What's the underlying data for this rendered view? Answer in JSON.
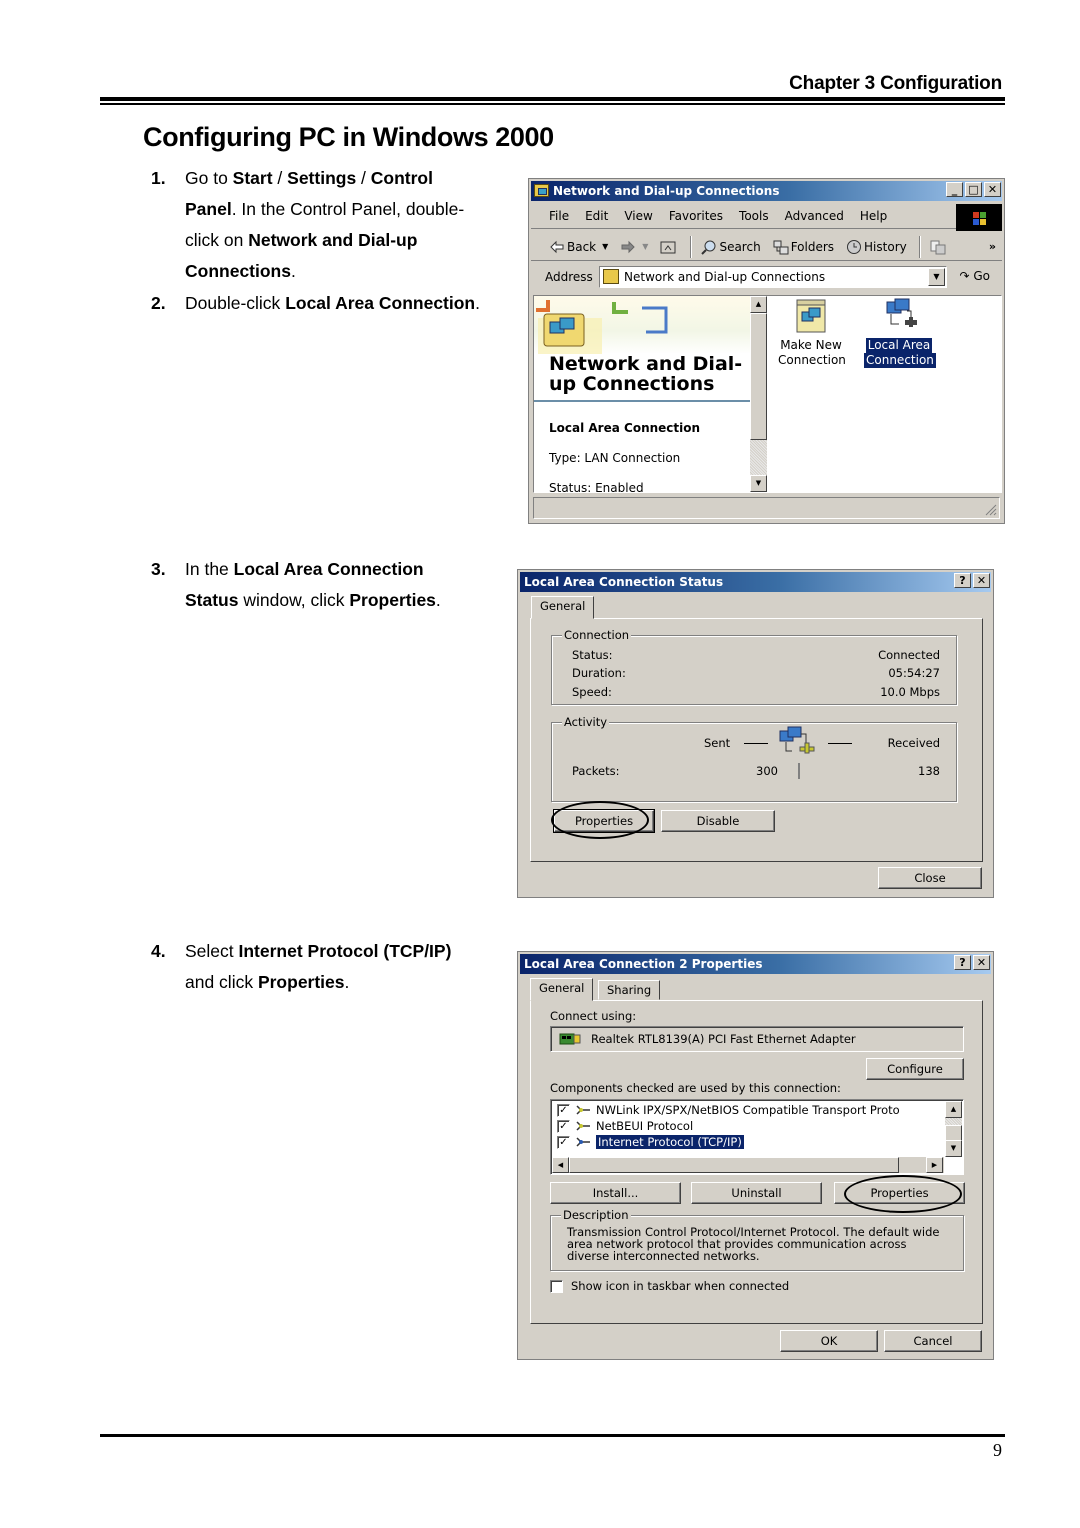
{
  "header": {
    "chapter": "Chapter 3 Configuration",
    "title": "Configuring PC in Windows 2000"
  },
  "steps": [
    {
      "num": "1.",
      "lines": [
        [
          {
            "t": "Go to ",
            "b": false
          },
          {
            "t": "Start",
            "b": true
          },
          {
            "t": " / ",
            "b": false
          },
          {
            "t": "Settings",
            "b": true
          },
          {
            "t": " / ",
            "b": false
          },
          {
            "t": "Control",
            "b": true
          }
        ],
        [
          {
            "t": "Panel",
            "b": true
          },
          {
            "t": ". In the Control Panel, double-",
            "b": false
          }
        ],
        [
          {
            "t": "click on ",
            "b": false
          },
          {
            "t": "Network and Dial-up",
            "b": true
          }
        ],
        [
          {
            "t": "Connections",
            "b": true
          },
          {
            "t": ".",
            "b": false
          }
        ]
      ]
    },
    {
      "num": "2.",
      "lines": [
        [
          {
            "t": "Double-click ",
            "b": false
          },
          {
            "t": "Local Area Connection",
            "b": true
          },
          {
            "t": ".",
            "b": false
          }
        ]
      ]
    },
    {
      "num": "3.",
      "lines": [
        [
          {
            "t": "In the ",
            "b": false
          },
          {
            "t": "Local Area Connection",
            "b": true
          }
        ],
        [
          {
            "t": "Status",
            "b": true
          },
          {
            "t": " window, click ",
            "b": false
          },
          {
            "t": "Properties",
            "b": true
          },
          {
            "t": ".",
            "b": false
          }
        ]
      ]
    },
    {
      "num": "4.",
      "lines": [
        [
          {
            "t": "Select ",
            "b": false
          },
          {
            "t": "Internet Protocol (TCP/IP)",
            "b": true
          }
        ],
        [
          {
            "t": "and click ",
            "b": false
          },
          {
            "t": "Properties",
            "b": true
          },
          {
            "t": ".",
            "b": false
          }
        ]
      ]
    }
  ],
  "window_network": {
    "title": "Network and Dial-up Connections",
    "menu": [
      "File",
      "Edit",
      "View",
      "Favorites",
      "Tools",
      "Advanced",
      "Help"
    ],
    "toolbar": {
      "back": "Back",
      "search": "Search",
      "folders": "Folders",
      "history": "History",
      "more": "»"
    },
    "address_label": "Address",
    "address_value": "Network and Dial-up Connections",
    "go_label": "Go",
    "left_pane": {
      "title": "Network and Dial-up Connections",
      "item_name": "Local Area Connection",
      "type": "Type: LAN Connection",
      "status": "Status: Enabled"
    },
    "icons": [
      {
        "line1": "Make New",
        "line2": "Connection",
        "selected": false
      },
      {
        "line1": "Local Area",
        "line2": "Connection",
        "selected": true
      }
    ]
  },
  "window_status": {
    "title": "Local Area Connection Status",
    "tab": "General",
    "connection_group": "Connection",
    "status_label": "Status:",
    "status_value": "Connected",
    "duration_label": "Duration:",
    "duration_value": "05:54:27",
    "speed_label": "Speed:",
    "speed_value": "10.0 Mbps",
    "activity_group": "Activity",
    "sent_label": "Sent",
    "received_label": "Received",
    "packets_label": "Packets:",
    "packets_sent": "300",
    "packets_received": "138",
    "properties_button": "Properties",
    "disable_button": "Disable",
    "close_button": "Close"
  },
  "window_properties": {
    "title": "Local Area Connection 2 Properties",
    "tabs": [
      "General",
      "Sharing"
    ],
    "connect_using_label": "Connect using:",
    "adapter": "Realtek RTL8139(A) PCI Fast Ethernet Adapter",
    "configure_button": "Configure",
    "components_label": "Components checked are used by this connection:",
    "components": [
      {
        "label": "NWLink IPX/SPX/NetBIOS Compatible Transport Proto",
        "checked": true,
        "selected": false
      },
      {
        "label": "NetBEUI Protocol",
        "checked": true,
        "selected": false
      },
      {
        "label": "Internet Protocol (TCP/IP)",
        "checked": true,
        "selected": true
      }
    ],
    "install_button": "Install...",
    "uninstall_button": "Uninstall",
    "properties_button": "Properties",
    "description_group": "Description",
    "description": "Transmission Control Protocol/Internet Protocol. The default wide area network protocol that provides communication across diverse interconnected networks.",
    "show_icon_label": "Show icon in taskbar when connected",
    "show_icon_checked": false,
    "ok_button": "OK",
    "cancel_button": "Cancel"
  },
  "footer": {
    "page_number": "9"
  }
}
